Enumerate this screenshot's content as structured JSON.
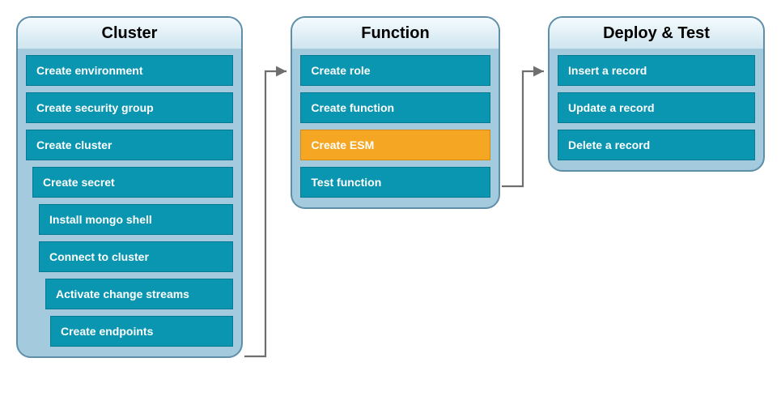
{
  "stages": {
    "cluster": {
      "title": "Cluster",
      "steps": [
        {
          "label": "Create environment",
          "indent": "indent-0"
        },
        {
          "label": "Create security group",
          "indent": "indent-0"
        },
        {
          "label": "Create cluster",
          "indent": "indent-0"
        },
        {
          "label": "Create secret",
          "indent": "indent-1"
        },
        {
          "label": "Install mongo shell",
          "indent": "indent-2"
        },
        {
          "label": "Connect to cluster",
          "indent": "indent-2"
        },
        {
          "label": "Activate change streams",
          "indent": "indent-3"
        },
        {
          "label": "Create endpoints",
          "indent": "indent-4"
        }
      ]
    },
    "function": {
      "title": "Function",
      "steps": [
        {
          "label": "Create role"
        },
        {
          "label": "Create function"
        },
        {
          "label": "Create ESM",
          "highlight": true
        },
        {
          "label": "Test function"
        }
      ]
    },
    "deploy": {
      "title": "Deploy & Test",
      "steps": [
        {
          "label": "Insert a record"
        },
        {
          "label": "Update a record"
        },
        {
          "label": "Delete a record"
        }
      ]
    }
  },
  "colors": {
    "step_bg": "#0a95b0",
    "step_highlight_bg": "#f5a623",
    "stage_border": "#5f8ea8",
    "stage_fill": "#a3cadd",
    "arrow": "#6f6f6f"
  }
}
